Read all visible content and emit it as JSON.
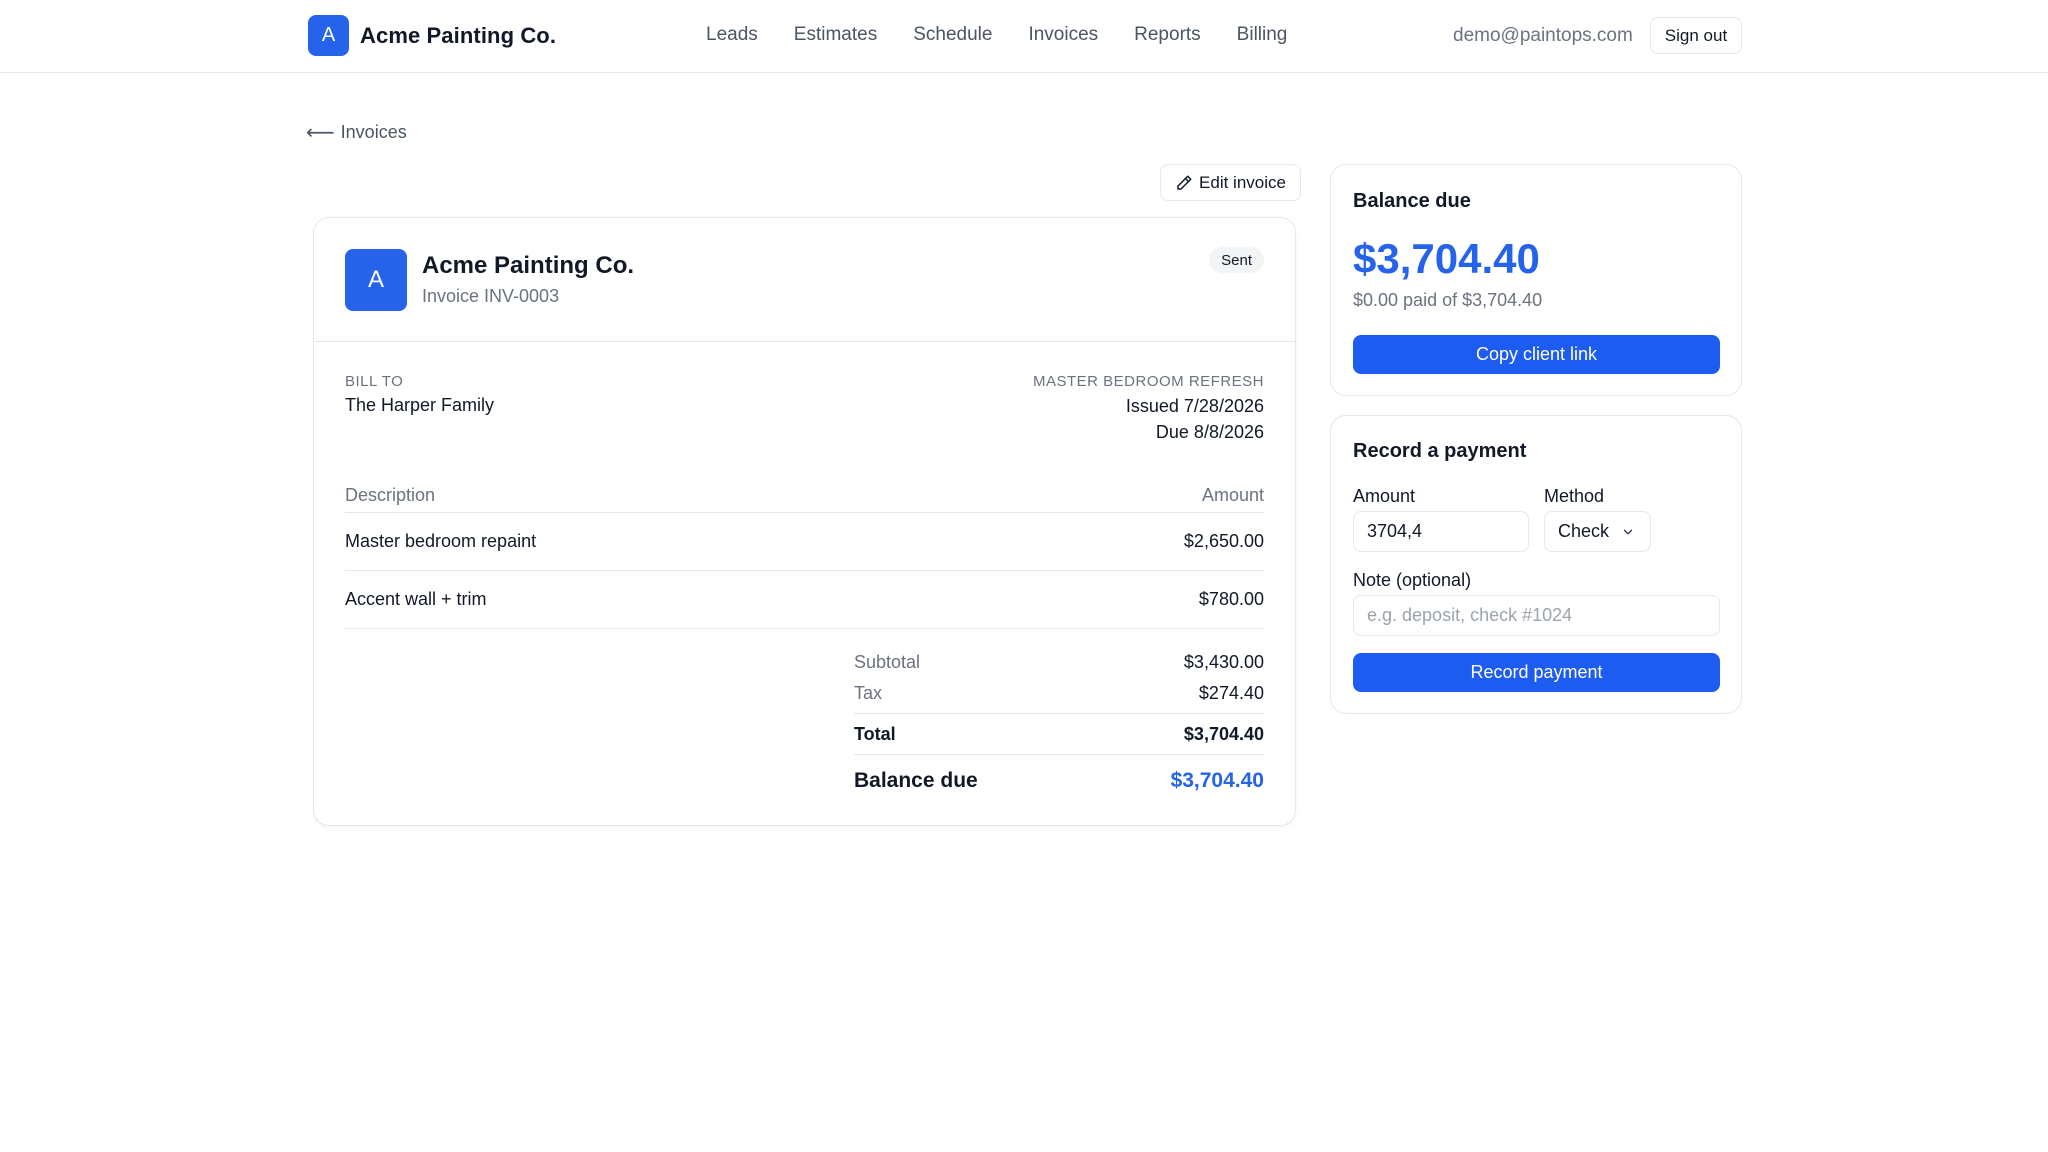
{
  "header": {
    "brand_initial": "A",
    "brand_name": "Acme Painting Co.",
    "nav": [
      "Leads",
      "Estimates",
      "Schedule",
      "Invoices",
      "Reports",
      "Billing"
    ],
    "user_email": "demo@paintops.com",
    "signout_label": "Sign out"
  },
  "back_link": {
    "arrow": "⟵",
    "label": "Invoices"
  },
  "edit_button_label": "Edit invoice",
  "invoice": {
    "logo_initial": "A",
    "company": "Acme Painting Co.",
    "number": "Invoice INV-0003",
    "status": "Sent",
    "bill_to_label": "BILL TO",
    "bill_to_name": "The Harper Family",
    "project": "MASTER BEDROOM REFRESH",
    "issued": "Issued 7/28/2026",
    "due": "Due 8/8/2026",
    "columns": {
      "description": "Description",
      "amount": "Amount"
    },
    "line_items": [
      {
        "description": "Master bedroom repaint",
        "amount": "$2,650.00"
      },
      {
        "description": "Accent wall + trim",
        "amount": "$780.00"
      }
    ],
    "totals": {
      "subtotal_label": "Subtotal",
      "subtotal": "$3,430.00",
      "tax_label": "Tax",
      "tax": "$274.40",
      "total_label": "Total",
      "total": "$3,704.40",
      "balance_label": "Balance due",
      "balance": "$3,704.40"
    }
  },
  "balance_panel": {
    "title": "Balance due",
    "amount": "$3,704.40",
    "paid_of": "$0.00 paid of $3,704.40",
    "copy_link_label": "Copy client link"
  },
  "payment_panel": {
    "title": "Record a payment",
    "amount_label": "Amount",
    "amount_value": "3704,4",
    "method_label": "Method",
    "method_value": "Check",
    "note_label": "Note (optional)",
    "note_placeholder": "e.g. deposit, check #1024",
    "submit_label": "Record payment"
  },
  "colors": {
    "accent": "#2563eb",
    "button": "#1d5cf0",
    "border": "#e5e7eb",
    "muted": "#6b7280"
  }
}
